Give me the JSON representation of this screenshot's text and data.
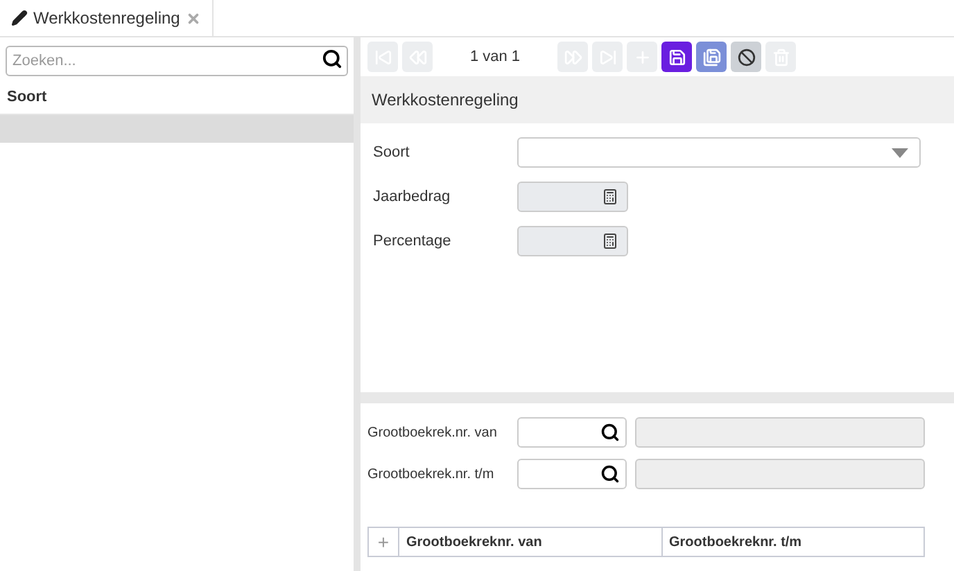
{
  "tab": {
    "title": "Werkkostenregeling"
  },
  "search": {
    "placeholder": "Zoeken..."
  },
  "list": {
    "column": "Soort",
    "rows": [
      {
        "selected": true
      }
    ]
  },
  "toolbar": [
    {
      "kind": "first",
      "disabled": true
    },
    {
      "kind": "previous",
      "disabled": true
    },
    {
      "kind": "counter",
      "text": "1 van 1"
    },
    {
      "kind": "next",
      "disabled": true
    },
    {
      "kind": "last",
      "disabled": true
    },
    {
      "kind": "add",
      "disabled": true
    },
    {
      "kind": "save",
      "disabled": false
    },
    {
      "kind": "save-as",
      "disabled": false
    },
    {
      "kind": "cancel",
      "disabled": false
    },
    {
      "kind": "delete",
      "disabled": true
    }
  ],
  "section_title": "Werkkostenregeling",
  "fields": [
    {
      "label": "Soort",
      "kind": "select"
    },
    {
      "label": "Jaarbedrag",
      "kind": "calc"
    },
    {
      "label": "Percentage",
      "kind": "calc"
    }
  ],
  "lookups": [
    {
      "label": "Grootboekrek.nr. van"
    },
    {
      "label": "Grootboekrek.nr. t/m"
    }
  ],
  "grid": {
    "add": "+",
    "columns": [
      "Grootboekreknr. van",
      "Grootboekreknr. t/m"
    ]
  }
}
